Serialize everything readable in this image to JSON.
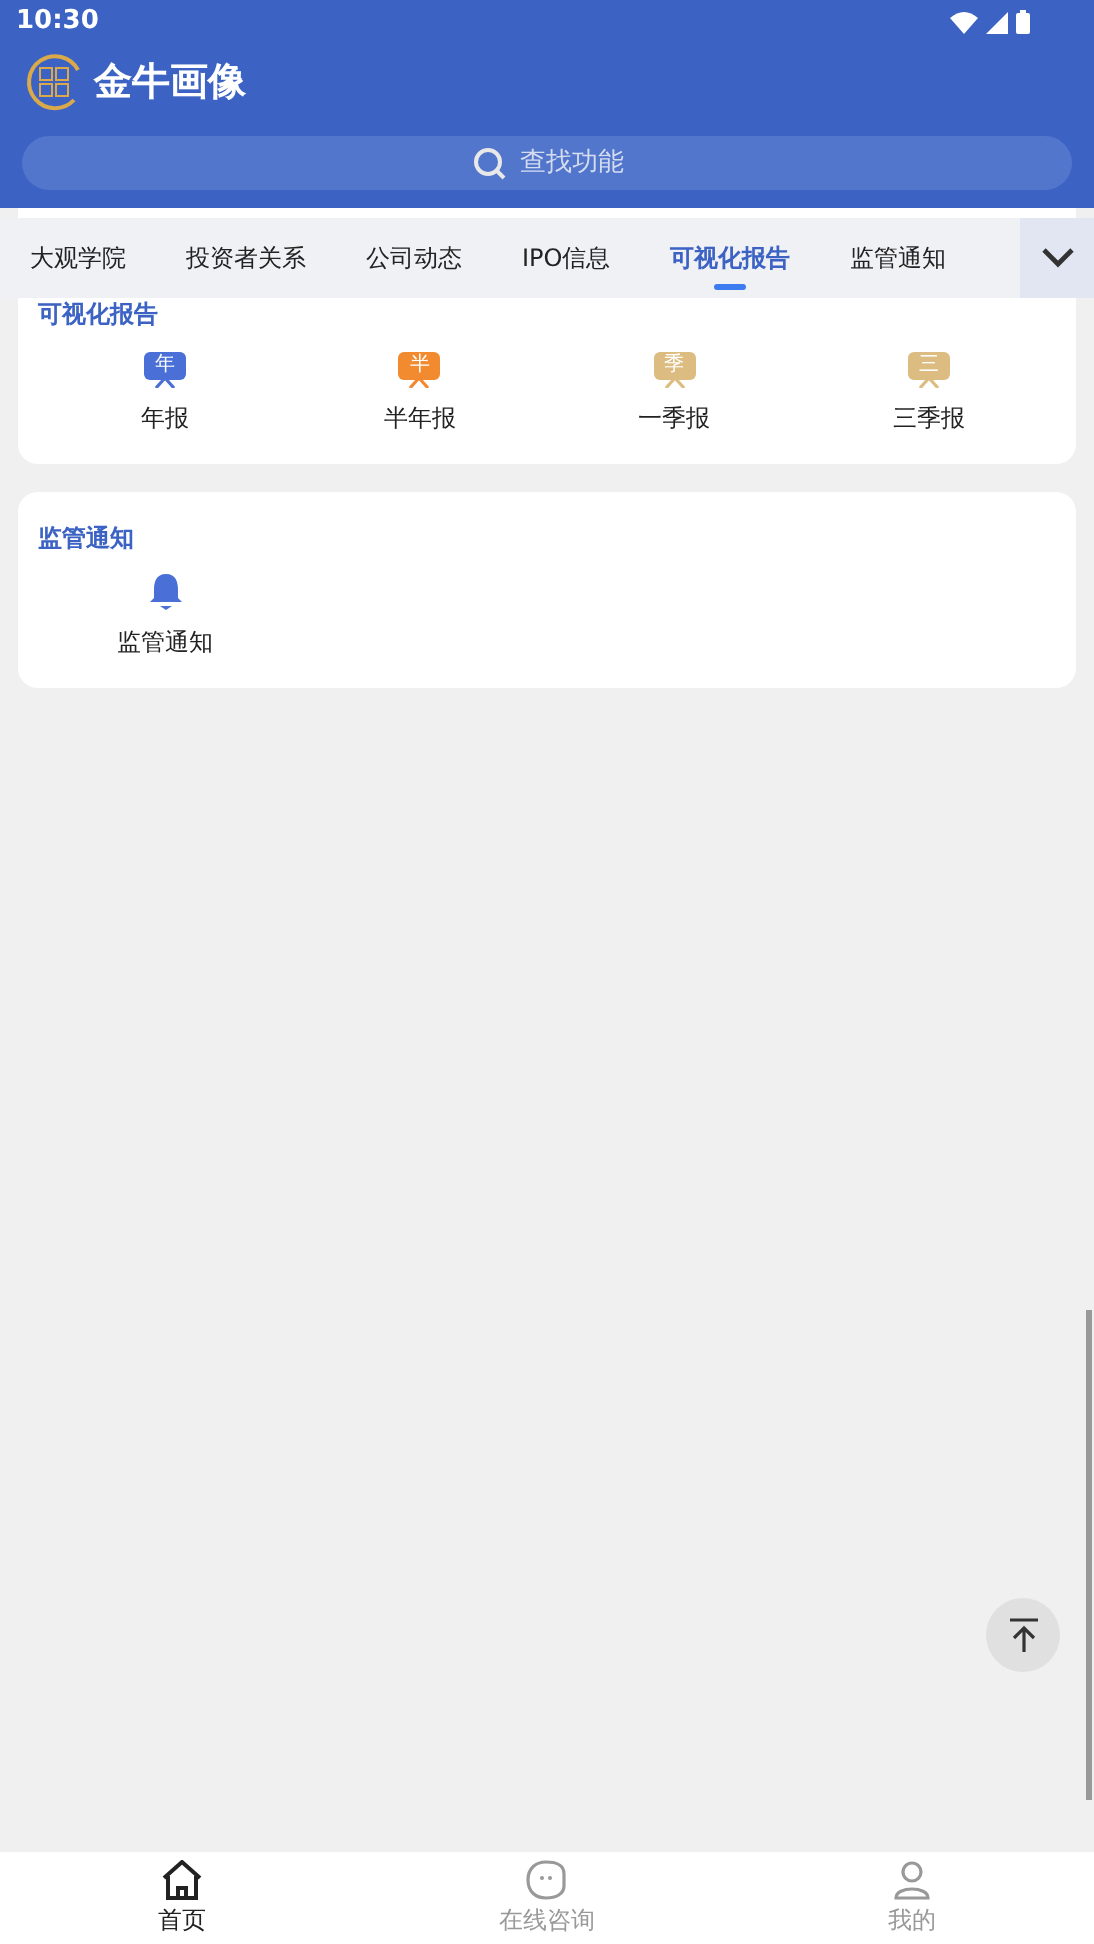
{
  "status_bar": {
    "time": "10:30"
  },
  "header": {
    "app_name": "金牛画像",
    "search": {
      "placeholder": "查找功能"
    }
  },
  "tabs": [
    {
      "label": "大观学院",
      "selected": false
    },
    {
      "label": "投资者关系",
      "selected": false
    },
    {
      "label": "公司动态",
      "selected": false
    },
    {
      "label": "IPO信息",
      "selected": false
    },
    {
      "label": "可视化报告",
      "selected": true
    },
    {
      "label": "监管通知",
      "selected": false
    }
  ],
  "sections": [
    {
      "title": "可视化报告",
      "items": [
        {
          "kind": "board",
          "glyph": "年",
          "label": "年报",
          "color": "#4a6fd6"
        },
        {
          "kind": "board",
          "glyph": "半",
          "label": "半年报",
          "color": "#f28a30"
        },
        {
          "kind": "board",
          "glyph": "季",
          "label": "一季报",
          "color": "#dcbc80"
        },
        {
          "kind": "board",
          "glyph": "三",
          "label": "三季报",
          "color": "#dcbc80"
        }
      ]
    },
    {
      "title": "监管通知",
      "items": [
        {
          "kind": "bell",
          "label": "监管通知",
          "color": "#4a6fd6"
        }
      ]
    }
  ],
  "bottom_nav": [
    {
      "kind": "home",
      "label": "首页",
      "selected": true
    },
    {
      "kind": "chat",
      "label": "在线咨询",
      "selected": false
    },
    {
      "kind": "user",
      "label": "我的",
      "selected": false
    }
  ]
}
